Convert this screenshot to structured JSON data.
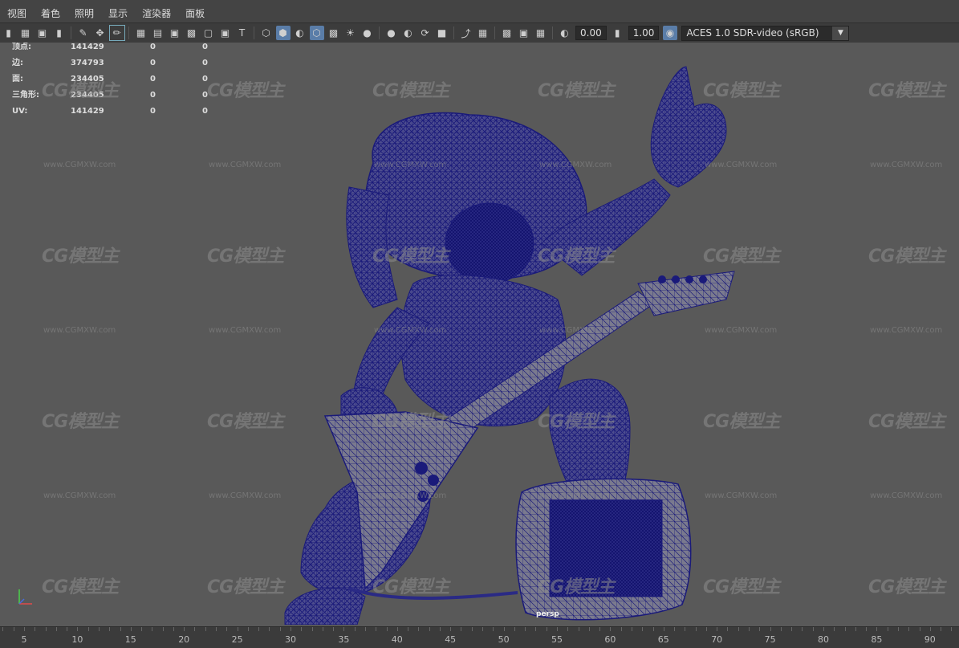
{
  "menu": [
    "视图",
    "着色",
    "照明",
    "显示",
    "渲染器",
    "面板"
  ],
  "toolbar": {
    "exposure_value": "0.00",
    "gamma_value": "1.00",
    "color_space": "ACES 1.0 SDR-video (sRGB)"
  },
  "hud_stats": [
    {
      "label": "顶点:",
      "value": "141429",
      "sel": "0",
      "comp": "0"
    },
    {
      "label": "边:",
      "value": "374793",
      "sel": "0",
      "comp": "0"
    },
    {
      "label": "面:",
      "value": "234405",
      "sel": "0",
      "comp": "0"
    },
    {
      "label": "三角形:",
      "value": "234405",
      "sel": "0",
      "comp": "0"
    },
    {
      "label": "UV:",
      "value": "141429",
      "sel": "0",
      "comp": "0"
    }
  ],
  "watermark": {
    "logo": "CG模型主",
    "url": "www.CGMXW.com"
  },
  "camera_label": "persp",
  "timeline_ticks": [
    "5",
    "10",
    "15",
    "20",
    "25",
    "30",
    "35",
    "40",
    "45",
    "50",
    "55",
    "60",
    "65",
    "70",
    "75",
    "80",
    "85",
    "90"
  ],
  "colors": {
    "wireframe": "#1a1a7a",
    "mesh_fill": "#4b4b8c",
    "viewport_bg": "#595959"
  }
}
